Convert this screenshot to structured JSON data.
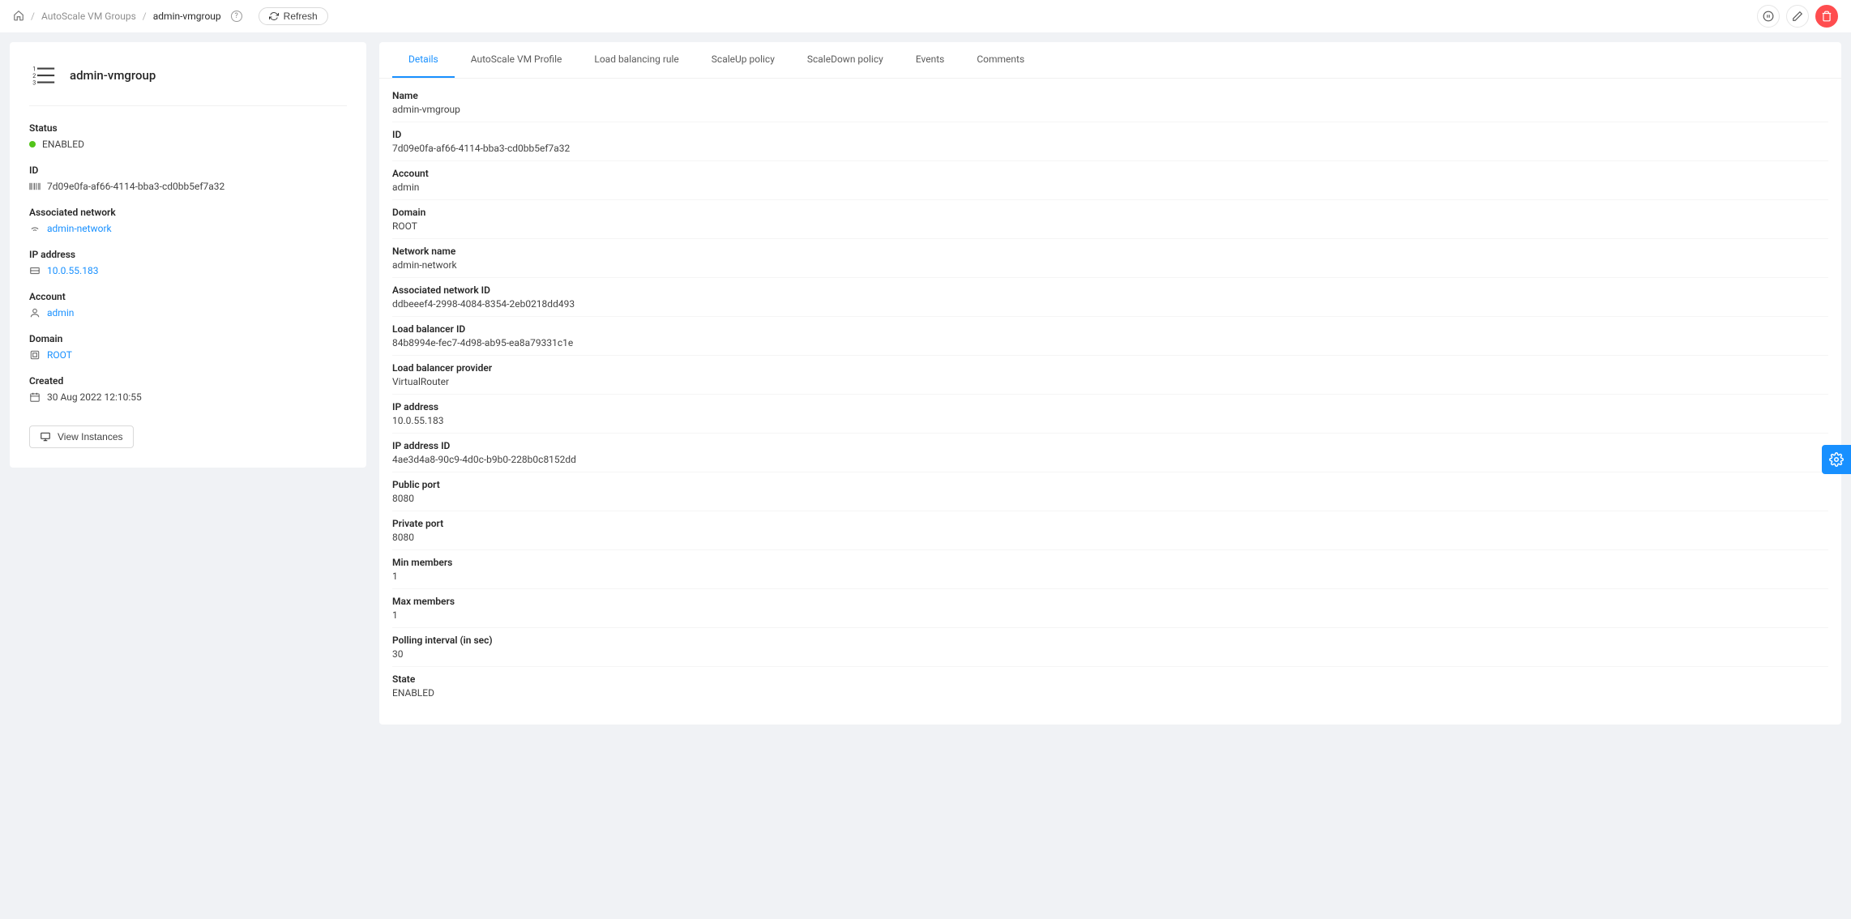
{
  "breadcrumbs": {
    "groups": "AutoScale VM Groups",
    "current": "admin-vmgroup"
  },
  "refresh_label": "Refresh",
  "side": {
    "title": "admin-vmgroup",
    "status_label": "Status",
    "status_value": "ENABLED",
    "id_label": "ID",
    "id_value": "7d09e0fa-af66-4114-bba3-cd0bb5ef7a32",
    "network_label": "Associated network",
    "network_value": "admin-network",
    "ip_label": "IP address",
    "ip_value": "10.0.55.183",
    "account_label": "Account",
    "account_value": "admin",
    "domain_label": "Domain",
    "domain_value": "ROOT",
    "created_label": "Created",
    "created_value": "30 Aug 2022 12:10:55",
    "view_instances": "View Instances"
  },
  "tabs": {
    "details": "Details",
    "profile": "AutoScale VM Profile",
    "lb": "Load balancing rule",
    "scaleup": "ScaleUp policy",
    "scaledown": "ScaleDown policy",
    "events": "Events",
    "comments": "Comments"
  },
  "details": [
    {
      "label": "Name",
      "value": "admin-vmgroup"
    },
    {
      "label": "ID",
      "value": "7d09e0fa-af66-4114-bba3-cd0bb5ef7a32"
    },
    {
      "label": "Account",
      "value": "admin"
    },
    {
      "label": "Domain",
      "value": "ROOT"
    },
    {
      "label": "Network name",
      "value": "admin-network"
    },
    {
      "label": "Associated network ID",
      "value": "ddbeeef4-2998-4084-8354-2eb0218dd493"
    },
    {
      "label": "Load balancer ID",
      "value": "84b8994e-fec7-4d98-ab95-ea8a79331c1e"
    },
    {
      "label": "Load balancer provider",
      "value": "VirtualRouter"
    },
    {
      "label": "IP address",
      "value": "10.0.55.183"
    },
    {
      "label": "IP address ID",
      "value": "4ae3d4a8-90c9-4d0c-b9b0-228b0c8152dd"
    },
    {
      "label": "Public port",
      "value": "8080"
    },
    {
      "label": "Private port",
      "value": "8080"
    },
    {
      "label": "Min members",
      "value": "1"
    },
    {
      "label": "Max members",
      "value": "1"
    },
    {
      "label": "Polling interval (in sec)",
      "value": "30"
    },
    {
      "label": "State",
      "value": "ENABLED"
    }
  ]
}
